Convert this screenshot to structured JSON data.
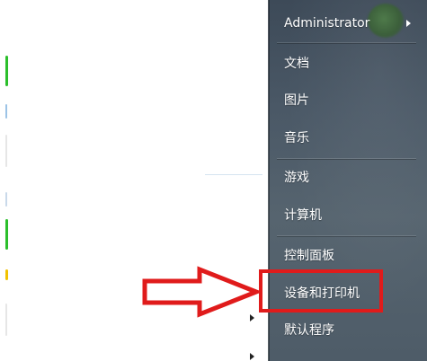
{
  "user": {
    "name": "Administrator"
  },
  "menu": {
    "items": [
      {
        "label": "文档"
      },
      {
        "label": "图片"
      },
      {
        "label": "音乐"
      },
      {
        "label": "游戏"
      },
      {
        "label": "计算机"
      },
      {
        "label": "控制面板"
      },
      {
        "label": "设备和打印机"
      },
      {
        "label": "默认程序"
      }
    ]
  },
  "colors": {
    "annotation": "#e01b1b",
    "right_pane": "#4a5866",
    "menu_text": "#ffffff"
  },
  "icons": {
    "user_submenu": "chevron-right-icon",
    "callout": "arrow-right-outline-icon"
  }
}
